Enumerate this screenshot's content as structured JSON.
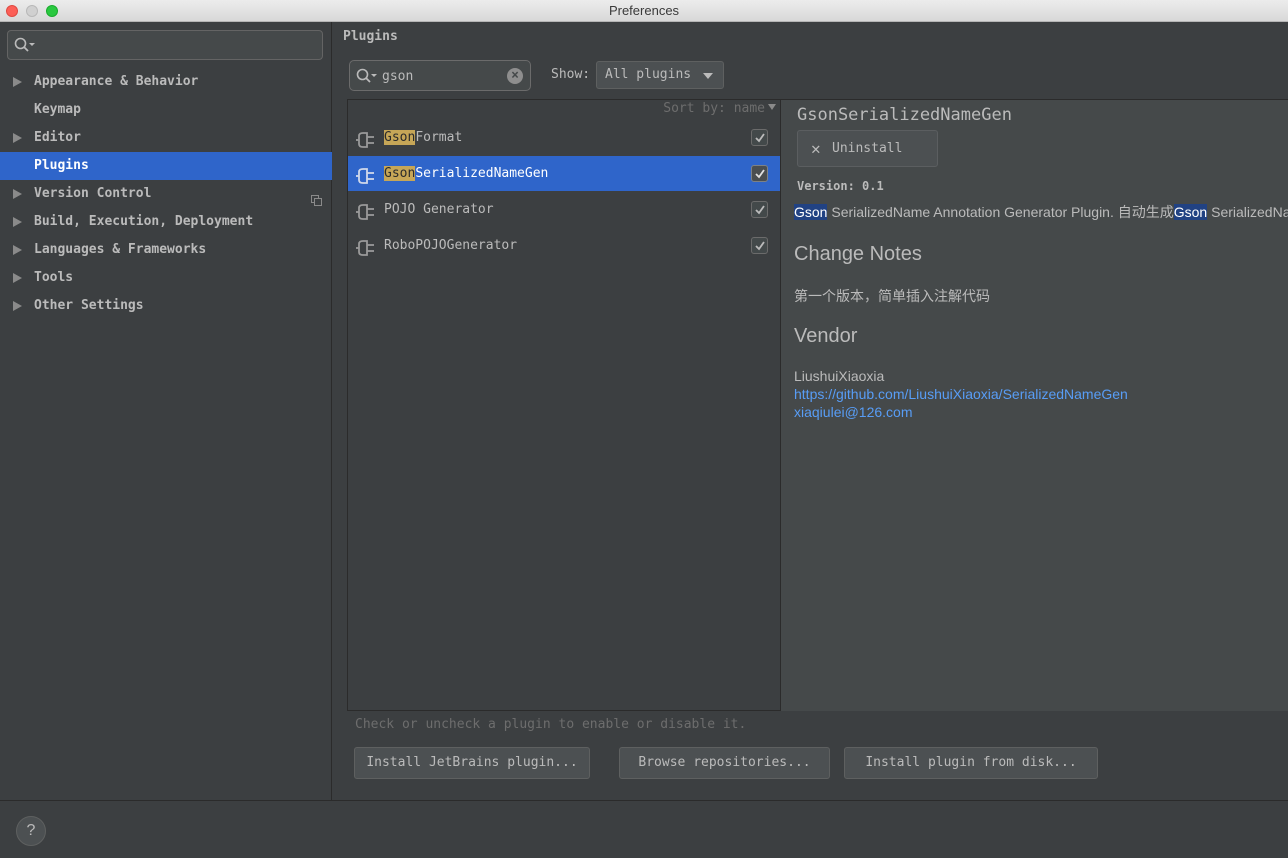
{
  "window": {
    "title": "Preferences"
  },
  "sidebar": {
    "search_placeholder": "",
    "items": [
      {
        "label": "Appearance & Behavior",
        "expandable": true
      },
      {
        "label": "Keymap",
        "expandable": false
      },
      {
        "label": "Editor",
        "expandable": true
      },
      {
        "label": "Plugins",
        "expandable": false,
        "selected": true
      },
      {
        "label": "Version Control",
        "expandable": true
      },
      {
        "label": "Build, Execution, Deployment",
        "expandable": true
      },
      {
        "label": "Languages & Frameworks",
        "expandable": true
      },
      {
        "label": "Tools",
        "expandable": true
      },
      {
        "label": "Other Settings",
        "expandable": true
      }
    ]
  },
  "main": {
    "title": "Plugins",
    "search_value": "gson",
    "show_label": "Show:",
    "show_value": "All plugins",
    "sort_label": "Sort by: name",
    "plugins": [
      {
        "highlight": "Gson",
        "rest": "Format",
        "enabled": true
      },
      {
        "highlight": "Gson",
        "rest": "SerializedNameGen",
        "enabled": true,
        "selected": true
      },
      {
        "highlight": "",
        "rest": "POJO Generator",
        "enabled": true
      },
      {
        "highlight": "",
        "rest": "RoboPOJOGenerator",
        "enabled": true
      }
    ],
    "hint": "Check or uncheck a plugin to enable or disable it.",
    "buttons": {
      "install_jetbrains": "Install JetBrains plugin...",
      "browse": "Browse repositories...",
      "install_disk": "Install plugin from disk..."
    }
  },
  "details": {
    "name": "GsonSerializedNameGen",
    "uninstall_label": "Uninstall",
    "version": "Version: 0.1",
    "desc_highlight_1": "Gson",
    "desc_part_1": " SerializedName Annotation Generator Plugin. 自动生成",
    "desc_highlight_2": "Gson",
    "desc_part_2": " SerializedName",
    "change_notes_heading": "Change Notes",
    "change_notes": "第一个版本，简单插入注解代码",
    "vendor_heading": "Vendor",
    "vendor_name": "LiushuiXiaoxia",
    "vendor_url": "https://github.com/LiushuiXiaoxia/SerializedNameGen",
    "vendor_email": "xiaqiulei@126.com"
  },
  "footer": {
    "help_label": "?"
  },
  "colors": {
    "accent": "#2f65ca",
    "match_highlight": "#c6a657",
    "link": "#589df6"
  }
}
